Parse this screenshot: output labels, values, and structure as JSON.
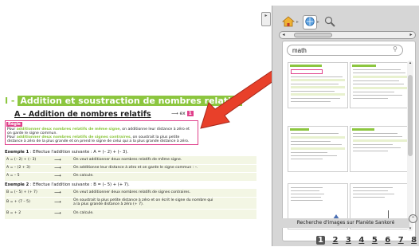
{
  "document": {
    "section_num": "I - ",
    "section_title": "Addition et soustraction de nombres relatifs",
    "subsection": "A - Addition de nombres relatifs",
    "ex_ref_arrow": "⟶ ex",
    "ex_ref_num": "1",
    "rule": {
      "tag": "Règle",
      "line1_a": "Pour ",
      "line1_b": "additionner deux nombres relatifs de même signe",
      "line1_c": ", on additionne leur distance à zéro et",
      "line2": "on garde le signe commun.",
      "line3_a": "Pour ",
      "line3_b": "additionner deux nombres relatifs de signes contraires",
      "line3_c": ", on soustrait la plus petite",
      "line4": "distance à zéro de la plus grande et on prend le signe de celui qui a la plus grande distance à zéro."
    },
    "example1": {
      "label": "Exemple 1",
      "text": " : Effectue l'addition suivante : A = (– 2) + (– 3).",
      "rows": [
        {
          "expr": "A = (– 2) + (– 3)",
          "arrow": "⟶",
          "expl": "On veut additionner deux nombres relatifs de même signe."
        },
        {
          "expr": "A = – (2 + 3)",
          "arrow": "⟶",
          "expl": "On additionne leur distance à zéro et on garde le signe commun : –."
        },
        {
          "expr": "A = – 5",
          "arrow": "⟶",
          "expl": "On calcule."
        }
      ]
    },
    "example2": {
      "label": "Exemple 2",
      "text": " : Effectue l'addition suivante : B = (– 5) + (+ 7).",
      "rows": [
        {
          "expr": "B = (– 5) + (+ 7)",
          "arrow": "⟶",
          "expl": "On veut additionner deux nombres relatifs de signes contraires."
        },
        {
          "expr": "B = + (7 – 5)",
          "arrow": "⟶",
          "expl": "On soustrait la plus petite distance à zéro et on écrit le signe du nombre qui",
          "expl2": "a la plus grande distance à zéro (+ 7)."
        },
        {
          "expr": "B = + 2",
          "arrow": "⟶",
          "expl": "On calcule."
        }
      ]
    }
  },
  "panel": {
    "toolbar": {
      "home_icon": "home-icon",
      "globe_icon": "globe-icon",
      "search_icon": "magnifier-icon",
      "sep": "▸"
    },
    "search": {
      "value": "math",
      "placeholder": ""
    },
    "pager": {
      "pages": [
        "1",
        "2",
        "3",
        "4",
        "5",
        "6",
        "7",
        "8"
      ],
      "current": "1"
    },
    "footer": "Recherche d'images sur Planète Sankoré"
  },
  "colors": {
    "accent_green": "#8cc63f",
    "accent_pink": "#e0408b",
    "arrow_red": "#e8402a",
    "panel_bg": "#d6d6d6"
  }
}
